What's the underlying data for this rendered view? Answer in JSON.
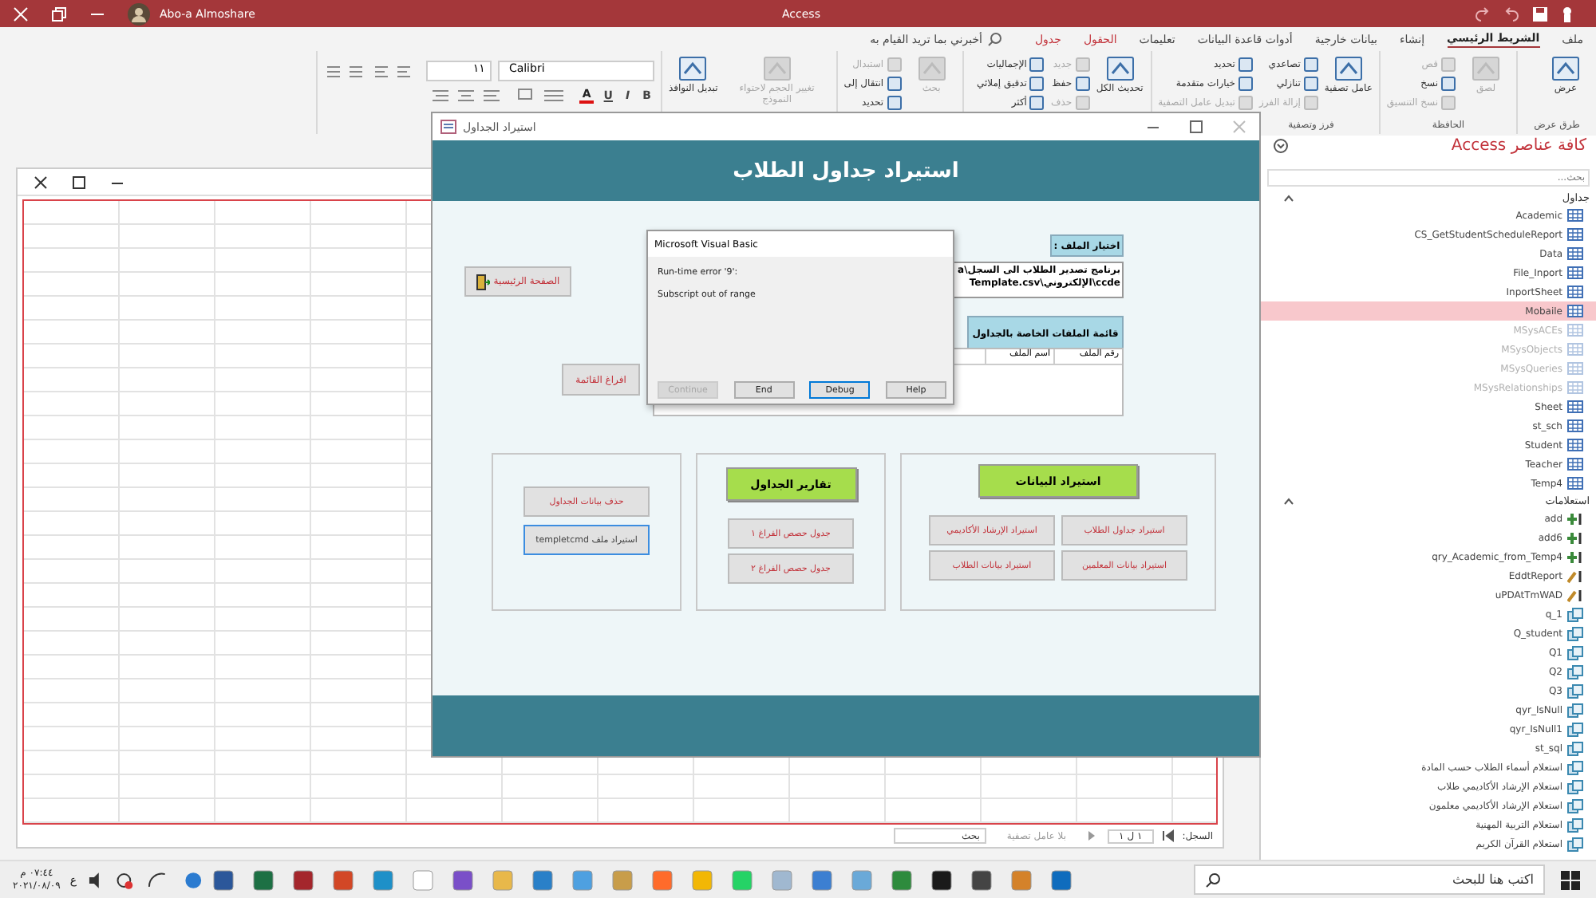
{
  "title_bar": {
    "app": "Access",
    "user": "Abo-a Almoshare"
  },
  "ribbon": {
    "tabs": [
      {
        "label": "ملف",
        "selected": false,
        "contextual": false
      },
      {
        "label": "الشريط الرئيسي",
        "selected": true,
        "contextual": false
      },
      {
        "label": "إنشاء",
        "selected": false,
        "contextual": false
      },
      {
        "label": "بيانات خارجية",
        "selected": false,
        "contextual": false
      },
      {
        "label": "أدوات قاعدة البيانات",
        "selected": false,
        "contextual": false
      },
      {
        "label": "تعليمات",
        "selected": false,
        "contextual": false
      },
      {
        "label": "الحقول",
        "selected": false,
        "contextual": true
      },
      {
        "label": "جدول",
        "selected": false,
        "contextual": true
      }
    ],
    "tell_me": "أخبرني بما تريد القيام به",
    "groups": [
      {
        "label": "طرق عرض",
        "columns": [
          {
            "kind": "large",
            "items": [
              {
                "label": "عرض",
                "disabled": false
              }
            ]
          }
        ]
      },
      {
        "label": "الحافظة",
        "columns": [
          {
            "kind": "large",
            "items": [
              {
                "label": "لصق",
                "disabled": true
              }
            ]
          },
          {
            "kind": "small",
            "items": [
              {
                "label": "قص",
                "disabled": true
              },
              {
                "label": "نسخ",
                "disabled": false
              },
              {
                "label": "نسخ التنسيق",
                "disabled": true
              }
            ]
          }
        ]
      },
      {
        "label": "فرز وتصفية",
        "columns": [
          {
            "kind": "large",
            "items": [
              {
                "label": "عامل تصفية",
                "disabled": false
              }
            ]
          },
          {
            "kind": "small",
            "items": [
              {
                "label": "تصاعدي",
                "disabled": false
              },
              {
                "label": "تنازلي",
                "disabled": false
              },
              {
                "label": "إزالة الفرز",
                "disabled": true
              }
            ]
          },
          {
            "kind": "small",
            "items": [
              {
                "label": "تحديد",
                "disabled": false
              },
              {
                "label": "خيارات متقدمة",
                "disabled": false
              },
              {
                "label": "تبديل عامل التصفية",
                "disabled": true
              }
            ]
          }
        ]
      },
      {
        "columns": [
          {
            "kind": "large",
            "items": [
              {
                "label": "تحديث الكل",
                "disabled": false
              }
            ]
          },
          {
            "kind": "small",
            "items": [
              {
                "label": "جديد",
                "disabled": true
              },
              {
                "label": "حفظ",
                "disabled": false
              },
              {
                "label": "حذف",
                "disabled": true
              }
            ]
          },
          {
            "kind": "small",
            "items": [
              {
                "label": "الإجماليات",
                "disabled": false
              },
              {
                "label": "تدقيق إملائي",
                "disabled": false
              },
              {
                "label": "أكثر",
                "disabled": false
              }
            ]
          }
        ]
      },
      {
        "columns": [
          {
            "kind": "large",
            "items": [
              {
                "label": "بحث",
                "disabled": true
              }
            ]
          },
          {
            "kind": "small",
            "items": [
              {
                "label": "استبدال",
                "disabled": true
              },
              {
                "label": "انتقال إلى",
                "disabled": false
              },
              {
                "label": "تحديد",
                "disabled": false
              }
            ]
          }
        ]
      },
      {
        "columns": [
          {
            "kind": "large",
            "items": [
              {
                "label": "تغيير الحجم لاحتواء النموذج",
                "disabled": true
              }
            ]
          },
          {
            "kind": "large",
            "items": [
              {
                "label": "تبديل النوافذ",
                "disabled": false
              }
            ]
          }
        ]
      }
    ],
    "font": {
      "name": "Calibri",
      "size": "١١"
    },
    "format_buttons": [
      "B",
      "I",
      "U",
      "A"
    ]
  },
  "datasheet": {
    "record_label": "السجل:",
    "record_position": "١ ل ١",
    "filter": "بلا عامل تصفية",
    "search_placeholder": "بحث"
  },
  "form_window": {
    "title": "استيراد الجداول",
    "header": "استيراد جداول الطلاب",
    "file_label": "اختيار الملف :",
    "file_path": "برنامج تصدير الطلاب الى السجل\\accde\\الإلكتروني\\Template.csv",
    "file_list_button": "قائمة الملفات الخاصة بالجداول",
    "file_list_columns": [
      "رقم الملف",
      "اسم الملف"
    ],
    "home_button": "الصفحة الرئيسية",
    "clear_button": "افراغ القائمة",
    "panels": [
      {
        "heading": "استيراد البيانات",
        "buttons": [
          {
            "label": "استيراد جداول الطلاب",
            "focused": false
          },
          {
            "label": "استيراد الإرشاد الأكاديمي",
            "focused": false
          },
          {
            "label": "استيراد بيانات المعلمين",
            "focused": false
          },
          {
            "label": "استيراد بيانات الطلاب",
            "focused": false
          }
        ]
      },
      {
        "heading": "تقارير الجداول",
        "buttons": [
          {
            "label": "جدول حصص الفراغ ١",
            "focused": false
          },
          {
            "label": "جدول حصص الفراغ ٢",
            "focused": false
          }
        ]
      },
      {
        "buttons": [
          {
            "label": "حذف بيانات الجداول",
            "focused": false
          },
          {
            "label": "استيراد ملف templetcmd",
            "focused": true
          }
        ]
      }
    ]
  },
  "dialog": {
    "title": "Microsoft Visual Basic",
    "lines": [
      "Run-time error '9':",
      "Subscript out of range"
    ],
    "continue_button": {
      "label": "Continue",
      "disabled": true,
      "focused": false
    },
    "end_button": {
      "label": "End",
      "disabled": false,
      "focused": false
    },
    "debug_button": {
      "label": "Debug",
      "disabled": false,
      "focused": true
    },
    "help_button": {
      "label": "Help",
      "disabled": false,
      "focused": false
    }
  },
  "navigation_pane": {
    "title": "كافة عناصر Access",
    "search_placeholder": "بحث...",
    "sections": [
      {
        "heading": "جداول",
        "items": [
          {
            "label": "Academic",
            "kind": "table",
            "hidden": false,
            "selected": false
          },
          {
            "label": "CS_GetStudentScheduleReport",
            "kind": "table",
            "hidden": false,
            "selected": false
          },
          {
            "label": "Data",
            "kind": "table",
            "hidden": false,
            "selected": false
          },
          {
            "label": "File_Inport",
            "kind": "table",
            "hidden": false,
            "selected": false
          },
          {
            "label": "InportSheet",
            "kind": "table",
            "hidden": false,
            "selected": false
          },
          {
            "label": "Mobaile",
            "kind": "table",
            "hidden": false,
            "selected": true
          },
          {
            "label": "MSysACEs",
            "kind": "table",
            "hidden": true,
            "selected": false
          },
          {
            "label": "MSysObjects",
            "kind": "table",
            "hidden": true,
            "selected": false
          },
          {
            "label": "MSysQueries",
            "kind": "table",
            "hidden": true,
            "selected": false
          },
          {
            "label": "MSysRelationships",
            "kind": "table",
            "hidden": true,
            "selected": false
          },
          {
            "label": "Sheet",
            "kind": "table",
            "hidden": false,
            "selected": false
          },
          {
            "label": "st_sch",
            "kind": "table",
            "hidden": false,
            "selected": false
          },
          {
            "label": "Student",
            "kind": "table",
            "hidden": false,
            "selected": false
          },
          {
            "label": "Teacher",
            "kind": "table",
            "hidden": false,
            "selected": false
          },
          {
            "label": "Temp4",
            "kind": "table",
            "hidden": false,
            "selected": false
          }
        ]
      },
      {
        "heading": "استعلامات",
        "items": [
          {
            "label": "add",
            "kind": "append",
            "hidden": false,
            "selected": false
          },
          {
            "label": "add6",
            "kind": "append",
            "hidden": false,
            "selected": false
          },
          {
            "label": "qry_Academic_from_Temp4",
            "kind": "append",
            "hidden": false,
            "selected": false
          },
          {
            "label": "EddtReport",
            "kind": "update",
            "hidden": false,
            "selected": false
          },
          {
            "label": "uPDAtTmWAD",
            "kind": "update",
            "hidden": false,
            "selected": false
          },
          {
            "label": "q_1",
            "kind": "select",
            "hidden": false,
            "selected": false
          },
          {
            "label": "Q_student",
            "kind": "select",
            "hidden": false,
            "selected": false
          },
          {
            "label": "Q1",
            "kind": "select",
            "hidden": false,
            "selected": false
          },
          {
            "label": "Q2",
            "kind": "select",
            "hidden": false,
            "selected": false
          },
          {
            "label": "Q3",
            "kind": "select",
            "hidden": false,
            "selected": false
          },
          {
            "label": "qyr_IsNull",
            "kind": "select",
            "hidden": false,
            "selected": false
          },
          {
            "label": "qyr_IsNull1",
            "kind": "select",
            "hidden": false,
            "selected": false
          },
          {
            "label": "st_sql",
            "kind": "select",
            "hidden": false,
            "selected": false
          },
          {
            "label": "استعلام أسماء الطلاب حسب المادة",
            "kind": "select",
            "hidden": false,
            "selected": false
          },
          {
            "label": "استعلام الإرشاد الأكاديمي طلاب",
            "kind": "select",
            "hidden": false,
            "selected": false
          },
          {
            "label": "استعلام الإرشاد الأكاديمي معلمون",
            "kind": "select",
            "hidden": false,
            "selected": false
          },
          {
            "label": "استعلام التربية المهنية",
            "kind": "select",
            "hidden": false,
            "selected": false
          },
          {
            "label": "استعلام القرآن الكريم",
            "kind": "select",
            "hidden": false,
            "selected": false
          }
        ]
      }
    ]
  },
  "taskbar": {
    "search_placeholder": "اكتب هنا للبحث",
    "language": "ع",
    "time": "٠٧:٤٤ م",
    "date": "٢٠٢١/٠٨/٠٩"
  }
}
